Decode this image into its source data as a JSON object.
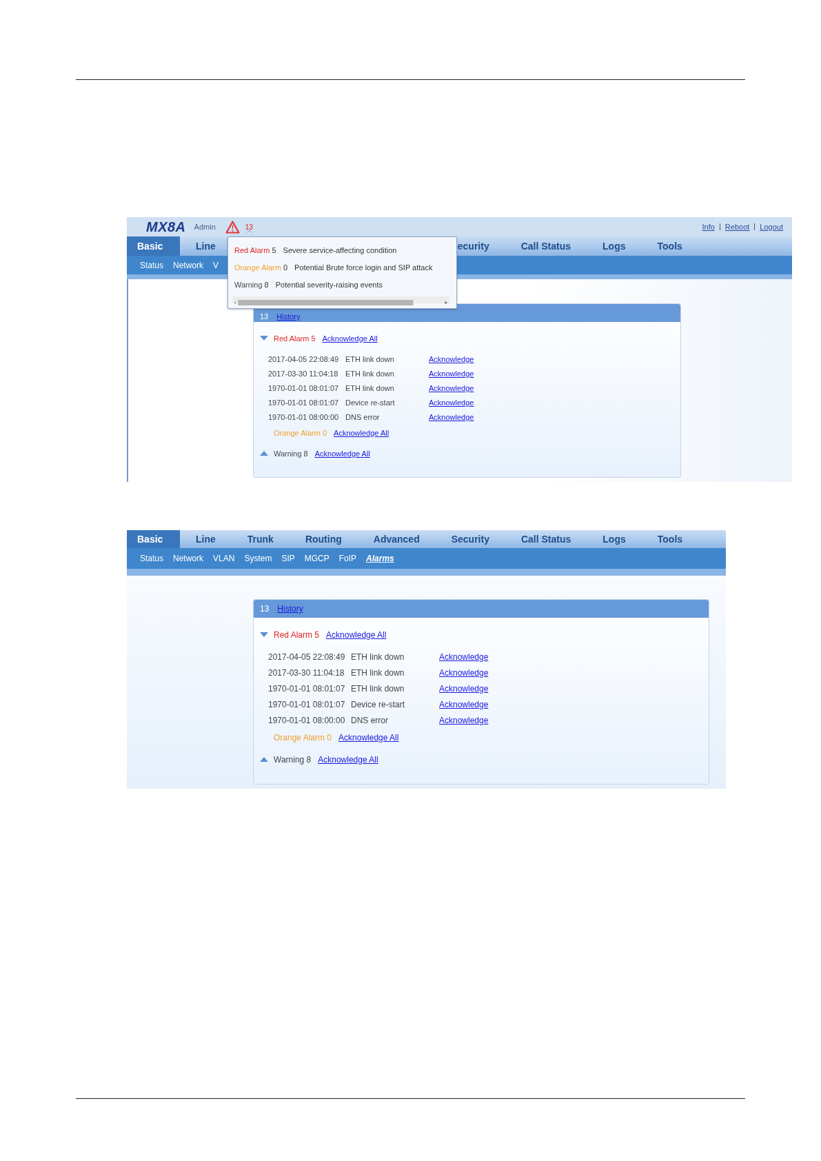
{
  "screenshot_1": {
    "header": {
      "logo": "MX8A",
      "user": "Admin",
      "alarm_count": "13",
      "links": [
        "Info",
        "Reboot",
        "Logout"
      ]
    },
    "tabs_left": [
      {
        "label": "Basic",
        "selected": true
      },
      {
        "label": "Line",
        "selected": false
      }
    ],
    "tabs_right": [
      {
        "label": "ecurity",
        "selected": false
      },
      {
        "label": "Call Status",
        "selected": false
      },
      {
        "label": "Logs",
        "selected": false
      },
      {
        "label": "Tools",
        "selected": false
      }
    ],
    "subnav": [
      {
        "label": "Status",
        "selected": false
      },
      {
        "label": "Network",
        "selected": false
      },
      {
        "label": "V",
        "selected": false
      }
    ],
    "alarm_popup": {
      "rows": [
        {
          "label": "Red Alarm",
          "count": "5",
          "description": "Severe service-affecting condition",
          "color": "#e02424"
        },
        {
          "label": "Orange Alarm",
          "count": "0",
          "description": "Potential Brute force login and SIP attack",
          "color": "#f0a030"
        },
        {
          "label": "Warning",
          "count": "8",
          "description": "Potential severity-raising events",
          "color": "#444444"
        }
      ]
    },
    "alarm_panel": {
      "total": "13",
      "history_link": "History",
      "sections": [
        {
          "label": "Red Alarm",
          "count": "5",
          "color": "#e02424",
          "expanded": true,
          "action": "Acknowledge All",
          "entries": [
            {
              "time": "2017-04-05 22:08:49",
              "event": "ETH link down",
              "action": "Acknowledge"
            },
            {
              "time": "2017-03-30 11:04:18",
              "event": "ETH link down",
              "action": "Acknowledge"
            },
            {
              "time": "1970-01-01 08:01:07",
              "event": "ETH link down",
              "action": "Acknowledge"
            },
            {
              "time": "1970-01-01 08:01:07",
              "event": "Device re-start",
              "action": "Acknowledge"
            },
            {
              "time": "1970-01-01 08:00:00",
              "event": "DNS error",
              "action": "Acknowledge"
            }
          ]
        },
        {
          "label": "Orange Alarm",
          "count": "0",
          "color": "#f0a030",
          "action": "Acknowledge All"
        },
        {
          "label": "Warning",
          "count": "8",
          "color": "#444444",
          "expanded": false,
          "action": "Acknowledge All"
        }
      ]
    }
  },
  "screenshot_2": {
    "tabs": [
      {
        "label": "Basic",
        "selected": true
      },
      {
        "label": "Line",
        "selected": false
      },
      {
        "label": "Trunk",
        "selected": false
      },
      {
        "label": "Routing",
        "selected": false
      },
      {
        "label": "Advanced",
        "selected": false
      },
      {
        "label": "Security",
        "selected": false
      },
      {
        "label": "Call Status",
        "selected": false
      },
      {
        "label": "Logs",
        "selected": false
      },
      {
        "label": "Tools",
        "selected": false
      }
    ],
    "subnav": [
      {
        "label": "Status",
        "selected": false
      },
      {
        "label": "Network",
        "selected": false
      },
      {
        "label": "VLAN",
        "selected": false
      },
      {
        "label": "System",
        "selected": false
      },
      {
        "label": "SIP",
        "selected": false
      },
      {
        "label": "MGCP",
        "selected": false
      },
      {
        "label": "FoIP",
        "selected": false
      },
      {
        "label": "Alarms",
        "selected": true
      }
    ],
    "alarm_panel": {
      "total": "13",
      "history_link": "History",
      "sections": [
        {
          "label": "Red Alarm",
          "count": "5",
          "color": "#e02424",
          "expanded": true,
          "action": "Acknowledge All",
          "entries": [
            {
              "time": "2017-04-05 22:08:49",
              "event": "ETH link down",
              "action": "Acknowledge"
            },
            {
              "time": "2017-03-30 11:04:18",
              "event": "ETH link down",
              "action": "Acknowledge"
            },
            {
              "time": "1970-01-01 08:01:07",
              "event": "ETH link down",
              "action": "Acknowledge"
            },
            {
              "time": "1970-01-01 08:01:07",
              "event": "Device re-start",
              "action": "Acknowledge"
            },
            {
              "time": "1970-01-01 08:00:00",
              "event": "DNS error",
              "action": "Acknowledge"
            }
          ]
        },
        {
          "label": "Orange Alarm",
          "count": "0",
          "color": "#f0a030",
          "action": "Acknowledge All"
        },
        {
          "label": "Warning",
          "count": "8",
          "color": "#444444",
          "expanded": false,
          "action": "Acknowledge All"
        }
      ]
    }
  }
}
